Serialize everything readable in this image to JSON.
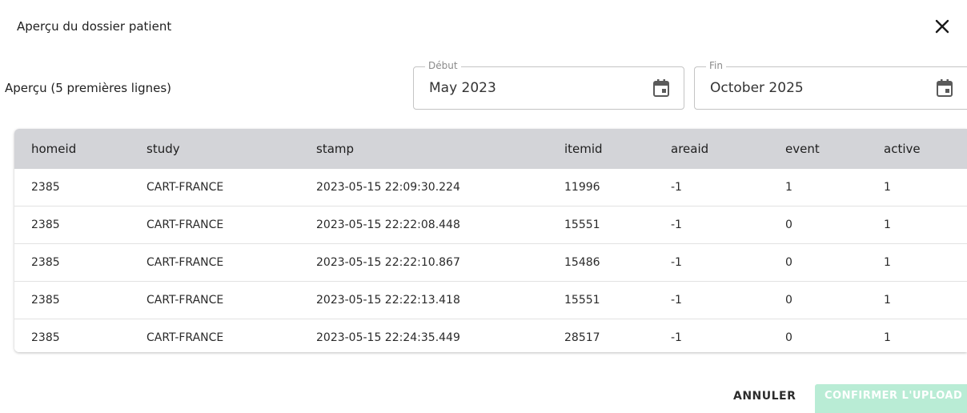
{
  "dialog": {
    "title": "Aperçu du dossier patient",
    "close_icon": "close-icon"
  },
  "preview": {
    "label": "Aperçu (5 premières lignes)"
  },
  "date_range": {
    "start": {
      "legend": "Début",
      "value": "May 2023",
      "icon": "calendar-icon"
    },
    "end": {
      "legend": "Fin",
      "value": "October 2025",
      "icon": "calendar-icon"
    }
  },
  "table": {
    "columns": [
      "homeid",
      "study",
      "stamp",
      "itemid",
      "areaid",
      "event",
      "active"
    ],
    "rows": [
      [
        "2385",
        "CART-FRANCE",
        "2023-05-15 22:09:30.224",
        "11996",
        "-1",
        "1",
        "1"
      ],
      [
        "2385",
        "CART-FRANCE",
        "2023-05-15 22:22:08.448",
        "15551",
        "-1",
        "0",
        "1"
      ],
      [
        "2385",
        "CART-FRANCE",
        "2023-05-15 22:22:10.867",
        "15486",
        "-1",
        "0",
        "1"
      ],
      [
        "2385",
        "CART-FRANCE",
        "2023-05-15 22:22:13.418",
        "15551",
        "-1",
        "0",
        "1"
      ],
      [
        "2385",
        "CART-FRANCE",
        "2023-05-15 22:24:35.449",
        "28517",
        "-1",
        "0",
        "1"
      ]
    ]
  },
  "actions": {
    "cancel_label": "ANNULER",
    "confirm_label": "CONFIRMER L'UPLOAD"
  },
  "colors": {
    "header_bg": "#d3d4d8",
    "confirm_bg": "#b9ecd5"
  }
}
